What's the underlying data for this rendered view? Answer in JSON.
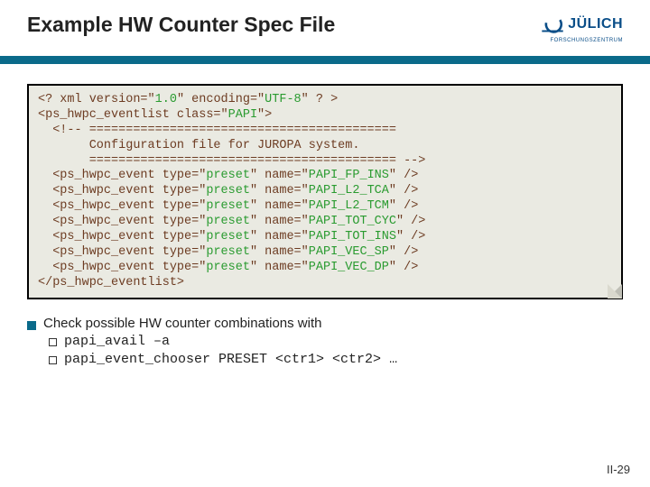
{
  "title": "Example HW Counter Spec File",
  "logo": {
    "name": "JÜLICH",
    "sub": "FORSCHUNGSZENTRUM"
  },
  "code": {
    "l1": "<? xml version=\"",
    "v1": "1.0",
    "l1b": "\" encoding=\"",
    "v1b": "UTF-8",
    "l1c": "\" ? >",
    "l2": "<ps_hwpc_eventlist class=\"",
    "v2": "PAPI",
    "l2b": "\">",
    "l3": "  <!-- ==========================================",
    "l4": "       Configuration file for JUROPA system.",
    "l5": "       ========================================== -->",
    "ev_prefix": "  <ps_hwpc_event type=\"",
    "ev_type": "preset",
    "ev_mid": "\" name=\"",
    "ev_sfx": "\" />",
    "names": [
      "PAPI_FP_INS",
      "PAPI_L2_TCA",
      "PAPI_L2_TCM",
      "PAPI_TOT_CYC",
      "PAPI_TOT_INS",
      "PAPI_VEC_SP",
      "PAPI_VEC_DP"
    ],
    "lend": "</ps_hwpc_eventlist>"
  },
  "bullet": {
    "main": "Check possible HW counter combinations with",
    "sub1a": "papi_avail",
    "sub1b": " –a",
    "sub2a": "papi_event_chooser",
    "sub2b": " PRESET <ctr1> <ctr2> …"
  },
  "pagenum": "II-29"
}
